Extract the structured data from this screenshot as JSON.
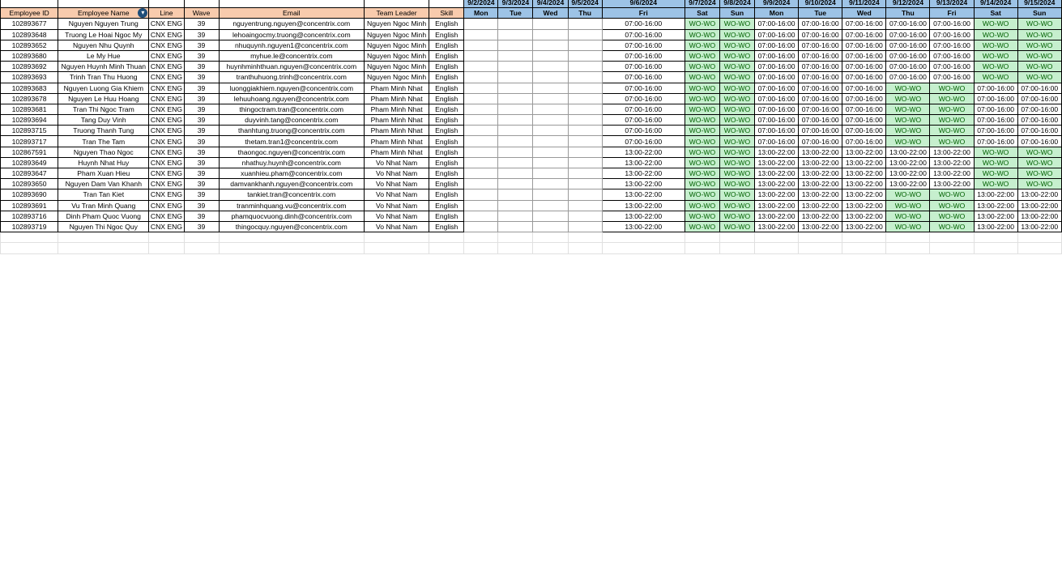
{
  "headers": [
    "Employee ID",
    "Employee Name",
    "Line",
    "Wave",
    "Email",
    "Team Leader",
    "Skill"
  ],
  "dates": [
    "9/2/2024",
    "9/3/2024",
    "9/4/2024",
    "9/5/2024",
    "9/6/2024",
    "9/7/2024",
    "9/8/2024",
    "9/9/2024",
    "9/10/2024",
    "9/11/2024",
    "9/12/2024",
    "9/13/2024",
    "9/14/2024",
    "9/15/2024"
  ],
  "weekdays": [
    "Mon",
    "Tue",
    "Wed",
    "Thu",
    "Fri",
    "Sat",
    "Sun",
    "Mon",
    "Tue",
    "Wed",
    "Thu",
    "Fri",
    "Sat",
    "Sun"
  ],
  "filter_icon": "filter-icon",
  "colors": {
    "header_fill": "#f8cbad",
    "date_fill": "#9dc3e6",
    "off_fill": "#c6efce",
    "off_text": "#006100"
  },
  "employees": [
    {
      "id": "102893677",
      "name": "Nguyen Nguyen Trung",
      "line": "CNX ENG",
      "wave": "39",
      "email": "nguyentrung.nguyen@concentrix.com",
      "leader": "Nguyen Ngoc Minh",
      "skill": "English",
      "shifts": [
        "",
        "",
        "",
        "",
        "07:00-16:00",
        "WO-WO",
        "WO-WO",
        "07:00-16:00",
        "07:00-16:00",
        "07:00-16:00",
        "07:00-16:00",
        "07:00-16:00",
        "WO-WO",
        "WO-WO"
      ]
    },
    {
      "id": "102893648",
      "name": "Truong Le Hoai Ngoc My",
      "line": "CNX ENG",
      "wave": "39",
      "email": "lehoaingocmy.truong@concentrix.com",
      "leader": "Nguyen Ngoc Minh",
      "skill": "English",
      "shifts": [
        "",
        "",
        "",
        "",
        "07:00-16:00",
        "WO-WO",
        "WO-WO",
        "07:00-16:00",
        "07:00-16:00",
        "07:00-16:00",
        "07:00-16:00",
        "07:00-16:00",
        "WO-WO",
        "WO-WO"
      ]
    },
    {
      "id": "102893652",
      "name": "Nguyen Nhu Quynh",
      "line": "CNX ENG",
      "wave": "39",
      "email": "nhuquynh.nguyen1@concentrix.com",
      "leader": "Nguyen Ngoc Minh",
      "skill": "English",
      "shifts": [
        "",
        "",
        "",
        "",
        "07:00-16:00",
        "WO-WO",
        "WO-WO",
        "07:00-16:00",
        "07:00-16:00",
        "07:00-16:00",
        "07:00-16:00",
        "07:00-16:00",
        "WO-WO",
        "WO-WO"
      ]
    },
    {
      "id": "102893680",
      "name": "Le My Hue",
      "line": "CNX ENG",
      "wave": "39",
      "email": "myhue.le@concentrix.com",
      "leader": "Nguyen Ngoc Minh",
      "skill": "English",
      "shifts": [
        "",
        "",
        "",
        "",
        "07:00-16:00",
        "WO-WO",
        "WO-WO",
        "07:00-16:00",
        "07:00-16:00",
        "07:00-16:00",
        "07:00-16:00",
        "07:00-16:00",
        "WO-WO",
        "WO-WO"
      ]
    },
    {
      "id": "102893692",
      "name": "Nguyen Huynh Minh Thuan",
      "line": "CNX ENG",
      "wave": "39",
      "email": "huynhminhthuan.nguyen@concentrix.com",
      "leader": "Nguyen Ngoc Minh",
      "skill": "English",
      "shifts": [
        "",
        "",
        "",
        "",
        "07:00-16:00",
        "WO-WO",
        "WO-WO",
        "07:00-16:00",
        "07:00-16:00",
        "07:00-16:00",
        "07:00-16:00",
        "07:00-16:00",
        "WO-WO",
        "WO-WO"
      ]
    },
    {
      "id": "102893693",
      "name": "Trinh Tran Thu Huong",
      "line": "CNX ENG",
      "wave": "39",
      "email": "tranthuhuong.trinh@concentrix.com",
      "leader": "Nguyen Ngoc Minh",
      "skill": "English",
      "shifts": [
        "",
        "",
        "",
        "",
        "07:00-16:00",
        "WO-WO",
        "WO-WO",
        "07:00-16:00",
        "07:00-16:00",
        "07:00-16:00",
        "07:00-16:00",
        "07:00-16:00",
        "WO-WO",
        "WO-WO"
      ]
    },
    {
      "id": "102893683",
      "name": "Nguyen Luong Gia Khiem",
      "line": "CNX ENG",
      "wave": "39",
      "email": "luonggiakhiem.nguyen@concentrix.com",
      "leader": "Pham Minh Nhat",
      "skill": "English",
      "shifts": [
        "",
        "",
        "",
        "",
        "07:00-16:00",
        "WO-WO",
        "WO-WO",
        "07:00-16:00",
        "07:00-16:00",
        "07:00-16:00",
        "WO-WO",
        "WO-WO",
        "07:00-16:00",
        "07:00-16:00"
      ]
    },
    {
      "id": "102893678",
      "name": "Nguyen Le Huu Hoang",
      "line": "CNX ENG",
      "wave": "39",
      "email": "lehuuhoang.nguyen@concentrix.com",
      "leader": "Pham Minh Nhat",
      "skill": "English",
      "shifts": [
        "",
        "",
        "",
        "",
        "07:00-16:00",
        "WO-WO",
        "WO-WO",
        "07:00-16:00",
        "07:00-16:00",
        "07:00-16:00",
        "WO-WO",
        "WO-WO",
        "07:00-16:00",
        "07:00-16:00"
      ]
    },
    {
      "id": "102893681",
      "name": "Tran Thi Ngoc Tram",
      "line": "CNX ENG",
      "wave": "39",
      "email": "thingoctram.tran@concentrix.com",
      "leader": "Pham Minh Nhat",
      "skill": "English",
      "shifts": [
        "",
        "",
        "",
        "",
        "07:00-16:00",
        "WO-WO",
        "WO-WO",
        "07:00-16:00",
        "07:00-16:00",
        "07:00-16:00",
        "WO-WO",
        "WO-WO",
        "07:00-16:00",
        "07:00-16:00"
      ]
    },
    {
      "id": "102893694",
      "name": "Tang Duy Vinh",
      "line": "CNX ENG",
      "wave": "39",
      "email": "duyvinh.tang@concentrix.com",
      "leader": "Pham Minh Nhat",
      "skill": "English",
      "shifts": [
        "",
        "",
        "",
        "",
        "07:00-16:00",
        "WO-WO",
        "WO-WO",
        "07:00-16:00",
        "07:00-16:00",
        "07:00-16:00",
        "WO-WO",
        "WO-WO",
        "07:00-16:00",
        "07:00-16:00"
      ]
    },
    {
      "id": "102893715",
      "name": "Truong Thanh Tung",
      "line": "CNX ENG",
      "wave": "39",
      "email": "thanhtung.truong@concentrix.com",
      "leader": "Pham Minh Nhat",
      "skill": "English",
      "shifts": [
        "",
        "",
        "",
        "",
        "07:00-16:00",
        "WO-WO",
        "WO-WO",
        "07:00-16:00",
        "07:00-16:00",
        "07:00-16:00",
        "WO-WO",
        "WO-WO",
        "07:00-16:00",
        "07:00-16:00"
      ]
    },
    {
      "id": "102893717",
      "name": "Tran The Tam",
      "line": "CNX ENG",
      "wave": "39",
      "email": "thetam.tran1@concentrix.com",
      "leader": "Pham Minh Nhat",
      "skill": "English",
      "shifts": [
        "",
        "",
        "",
        "",
        "07:00-16:00",
        "WO-WO",
        "WO-WO",
        "07:00-16:00",
        "07:00-16:00",
        "07:00-16:00",
        "WO-WO",
        "WO-WO",
        "07:00-16:00",
        "07:00-16:00"
      ]
    },
    {
      "id": "102867591",
      "name": "Nguyen Thao Ngoc",
      "line": "CNX ENG",
      "wave": "39",
      "email": "thaongoc.nguyen@concentrix.com",
      "leader": "Pham Minh Nhat",
      "skill": "English",
      "shifts": [
        "",
        "",
        "",
        "",
        "13:00-22:00",
        "WO-WO",
        "WO-WO",
        "13:00-22:00",
        "13:00-22:00",
        "13:00-22:00",
        "13:00-22:00",
        "13:00-22:00",
        "WO-WO",
        "WO-WO"
      ]
    },
    {
      "id": "102893649",
      "name": "Huynh Nhat Huy",
      "line": "CNX ENG",
      "wave": "39",
      "email": "nhathuy.huynh@concentrix.com",
      "leader": "Vo Nhat Nam",
      "skill": "English",
      "shifts": [
        "",
        "",
        "",
        "",
        "13:00-22:00",
        "WO-WO",
        "WO-WO",
        "13:00-22:00",
        "13:00-22:00",
        "13:00-22:00",
        "13:00-22:00",
        "13:00-22:00",
        "WO-WO",
        "WO-WO"
      ]
    },
    {
      "id": "102893647",
      "name": "Pham Xuan Hieu",
      "line": "CNX ENG",
      "wave": "39",
      "email": "xuanhieu.pham@concentrix.com",
      "leader": "Vo Nhat Nam",
      "skill": "English",
      "shifts": [
        "",
        "",
        "",
        "",
        "13:00-22:00",
        "WO-WO",
        "WO-WO",
        "13:00-22:00",
        "13:00-22:00",
        "13:00-22:00",
        "13:00-22:00",
        "13:00-22:00",
        "WO-WO",
        "WO-WO"
      ]
    },
    {
      "id": "102893650",
      "name": "Nguyen Dam Van Khanh",
      "line": "CNX ENG",
      "wave": "39",
      "email": "damvankhanh.nguyen@concentrix.com",
      "leader": "Vo Nhat Nam",
      "skill": "English",
      "shifts": [
        "",
        "",
        "",
        "",
        "13:00-22:00",
        "WO-WO",
        "WO-WO",
        "13:00-22:00",
        "13:00-22:00",
        "13:00-22:00",
        "13:00-22:00",
        "13:00-22:00",
        "WO-WO",
        "WO-WO"
      ]
    },
    {
      "id": "102893690",
      "name": "Tran Tan Kiet",
      "line": "CNX ENG",
      "wave": "39",
      "email": "tankiet.tran@concentrix.com",
      "leader": "Vo Nhat Nam",
      "skill": "English",
      "shifts": [
        "",
        "",
        "",
        "",
        "13:00-22:00",
        "WO-WO",
        "WO-WO",
        "13:00-22:00",
        "13:00-22:00",
        "13:00-22:00",
        "WO-WO",
        "WO-WO",
        "13:00-22:00",
        "13:00-22:00"
      ]
    },
    {
      "id": "102893691",
      "name": "Vu Tran Minh Quang",
      "line": "CNX ENG",
      "wave": "39",
      "email": "tranminhquang.vu@concentrix.com",
      "leader": "Vo Nhat Nam",
      "skill": "English",
      "shifts": [
        "",
        "",
        "",
        "",
        "13:00-22:00",
        "WO-WO",
        "WO-WO",
        "13:00-22:00",
        "13:00-22:00",
        "13:00-22:00",
        "WO-WO",
        "WO-WO",
        "13:00-22:00",
        "13:00-22:00"
      ]
    },
    {
      "id": "102893716",
      "name": "Dinh Pham Quoc Vuong",
      "line": "CNX ENG",
      "wave": "39",
      "email": "phamquocvuong.dinh@concentrix.com",
      "leader": "Vo Nhat Nam",
      "skill": "English",
      "shifts": [
        "",
        "",
        "",
        "",
        "13:00-22:00",
        "WO-WO",
        "WO-WO",
        "13:00-22:00",
        "13:00-22:00",
        "13:00-22:00",
        "WO-WO",
        "WO-WO",
        "13:00-22:00",
        "13:00-22:00"
      ]
    },
    {
      "id": "102893719",
      "name": "Nguyen Thi Ngoc Quy",
      "line": "CNX ENG",
      "wave": "39",
      "email": "thingocquy.nguyen@concentrix.com",
      "leader": "Vo Nhat Nam",
      "skill": "English",
      "shifts": [
        "",
        "",
        "",
        "",
        "13:00-22:00",
        "WO-WO",
        "WO-WO",
        "13:00-22:00",
        "13:00-22:00",
        "13:00-22:00",
        "WO-WO",
        "WO-WO",
        "13:00-22:00",
        "13:00-22:00"
      ]
    }
  ]
}
